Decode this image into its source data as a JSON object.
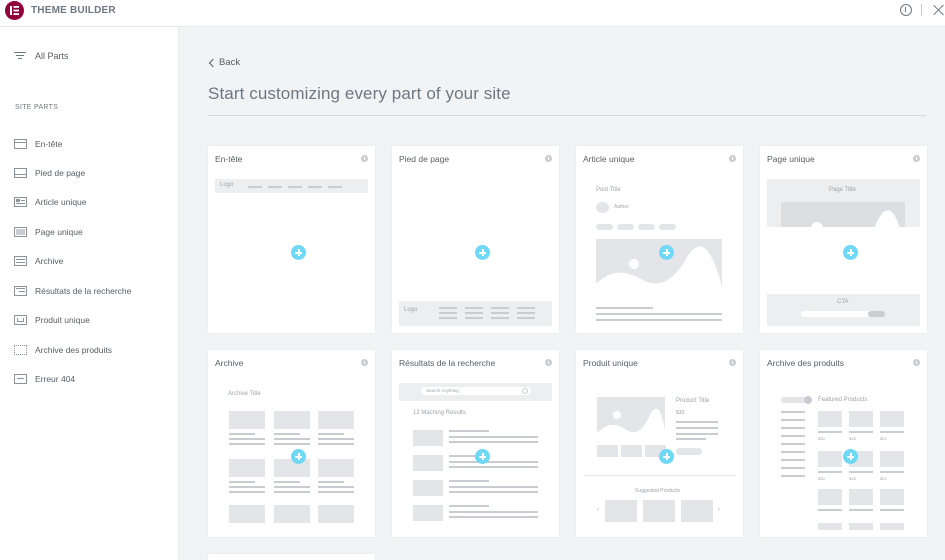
{
  "app": {
    "title": "THEME BUILDER"
  },
  "sidebar": {
    "all_parts_label": "All Parts",
    "section_title": "SITE PARTS",
    "items": [
      {
        "label": "En-tête",
        "icon": "header-layout-icon"
      },
      {
        "label": "Pied de page",
        "icon": "footer-layout-icon"
      },
      {
        "label": "Article unique",
        "icon": "single-post-icon"
      },
      {
        "label": "Page unique",
        "icon": "single-page-icon"
      },
      {
        "label": "Archive",
        "icon": "archive-icon"
      },
      {
        "label": "Résultats de la recherche",
        "icon": "search-results-icon"
      },
      {
        "label": "Produit unique",
        "icon": "single-product-icon"
      },
      {
        "label": "Archive des produits",
        "icon": "products-archive-icon"
      },
      {
        "label": "Erreur 404",
        "icon": "error-404-icon"
      }
    ]
  },
  "main": {
    "back_label": "Back",
    "title": "Start customizing every part of your site",
    "cards": [
      {
        "title": "En-tête"
      },
      {
        "title": "Pied de page"
      },
      {
        "title": "Article unique"
      },
      {
        "title": "Page unique"
      },
      {
        "title": "Archive"
      },
      {
        "title": "Résultats de la recherche"
      },
      {
        "title": "Produit unique"
      },
      {
        "title": "Archive des produits"
      }
    ],
    "previews": {
      "header_logo": "Logo",
      "footer_logo": "Logo",
      "post_title": "Post Title",
      "author": "Author",
      "page_title": "Page Title",
      "cta": "CTA",
      "archive_title": "Archive Title",
      "search_placeholder": "Search Anything",
      "search_results": "12 Maching Results",
      "product_title": "Product Title",
      "product_price": "$30",
      "suggested_products": "Suggested Products",
      "featured_products": "Featured Products",
      "prices": [
        "$30",
        "$15",
        "$22",
        "$30",
        "$15",
        "$22"
      ]
    }
  },
  "colors": {
    "brand": "#92003b",
    "accent": "#71d7f7",
    "background": "#f1f3f5"
  }
}
